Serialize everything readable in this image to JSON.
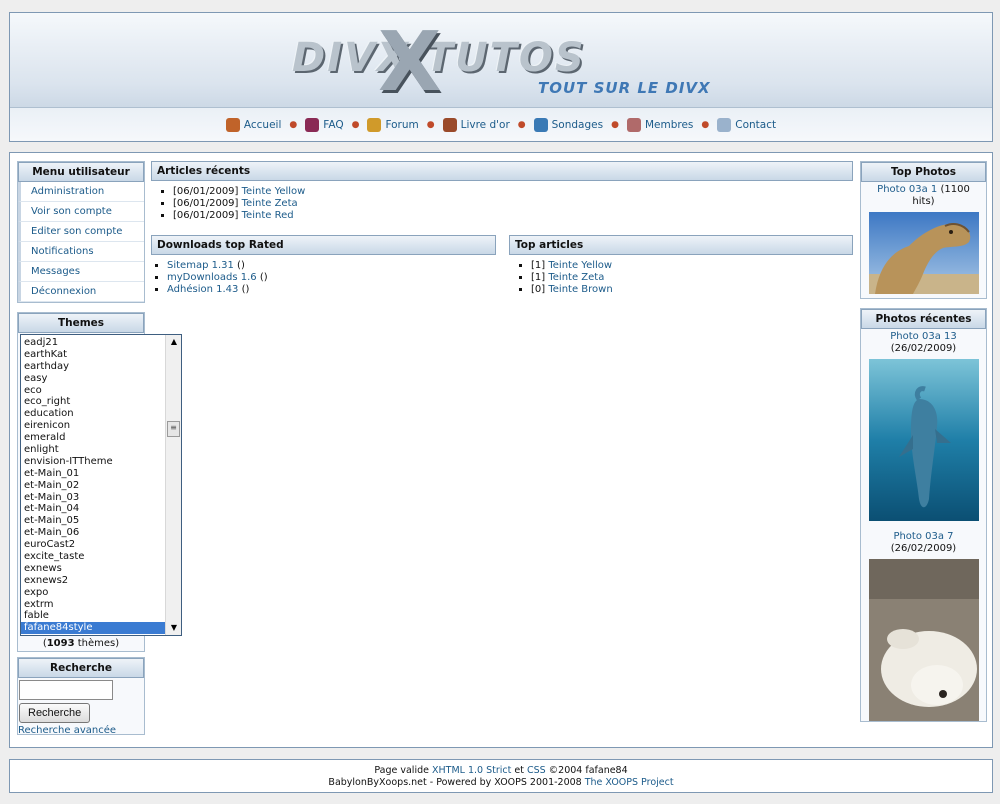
{
  "header": {
    "logo_title": "DIVX TUTOS",
    "logo_x": "X",
    "logo_tagline": "TOUT SUR LE DIVX",
    "nav": [
      {
        "label": "Accueil",
        "icon": "home-icon",
        "color": "#c0632a"
      },
      {
        "label": "FAQ",
        "icon": "book-icon",
        "color": "#8a2a55"
      },
      {
        "label": "Forum",
        "icon": "gift-icon",
        "color": "#d09a2a"
      },
      {
        "label": "Livre d'or",
        "icon": "guestbook-icon",
        "color": "#9a4a2a"
      },
      {
        "label": "Sondages",
        "icon": "poll-icon",
        "color": "#3a7ab5"
      },
      {
        "label": "Membres",
        "icon": "members-icon",
        "color": "#b06a6a"
      },
      {
        "label": "Contact",
        "icon": "contact-icon",
        "color": "#9ab2cc"
      }
    ],
    "nav_separator": "●"
  },
  "user_menu": {
    "title": "Menu utilisateur",
    "items": [
      "Administration",
      "Voir son compte",
      "Editer son compte",
      "Notifications",
      "Messages",
      "Déconnexion"
    ]
  },
  "themes": {
    "title": "Themes",
    "options": [
      "eadj21",
      "earthKat",
      "earthday",
      "easy",
      "eco",
      "eco_right",
      "education",
      "eirenicon",
      "emerald",
      "enlight",
      "envision-ITTheme",
      "et-Main_01",
      "et-Main_02",
      "et-Main_03",
      "et-Main_04",
      "et-Main_05",
      "et-Main_06",
      "euroCast2",
      "excite_taste",
      "exnews",
      "exnews2",
      "expo",
      "extrm",
      "fable",
      "fafane84style"
    ],
    "selected": "fafane84style",
    "count_prefix": "(",
    "count": "1093",
    "count_suffix": " thèmes)"
  },
  "search": {
    "title": "Recherche",
    "input_value": "",
    "button_label": "Recherche",
    "advanced_link": "Recherche avancée"
  },
  "recent_articles": {
    "title": "Articles récents",
    "items": [
      {
        "date": "[06/01/2009]",
        "link": "Teinte Yellow"
      },
      {
        "date": "[06/01/2009]",
        "link": "Teinte Zeta"
      },
      {
        "date": "[06/01/2009]",
        "link": "Teinte Red"
      }
    ]
  },
  "downloads": {
    "title": "Downloads top Rated",
    "items": [
      {
        "link": "Sitemap 1.31",
        "suffix": " ()"
      },
      {
        "link": "myDownloads 1.6",
        "suffix": " ()"
      },
      {
        "link": "Adhésion 1.43",
        "suffix": " ()"
      }
    ]
  },
  "top_articles": {
    "title": "Top articles",
    "items": [
      {
        "count": "[1]",
        "link": "Teinte Yellow"
      },
      {
        "count": "[1]",
        "link": "Teinte Zeta"
      },
      {
        "count": "[0]",
        "link": "Teinte Brown"
      }
    ]
  },
  "top_photos": {
    "title": "Top Photos",
    "photo_link": "Photo 03a 1",
    "photo_hits": " (1100 hits)"
  },
  "recent_photos": {
    "title": "Photos récentes",
    "photos": [
      {
        "link": "Photo 03a 13",
        "date": " (26/02/2009)"
      },
      {
        "link": "Photo 03a 7",
        "date": " (26/02/2009)"
      }
    ]
  },
  "footer": {
    "line1_prefix": "Page valide ",
    "xhtml_link": "XHTML 1.0 Strict",
    "line1_mid": " et ",
    "css_link": "CSS",
    "line1_suffix": "  ©2004 fafane84",
    "line2_prefix": "BabylonByXoops.net - Powered by XOOPS 2001-2008 ",
    "xoops_link": "The XOOPS Project"
  },
  "colors": {
    "link": "#1c5b8a",
    "border": "#7e98b3",
    "title_gradient_bottom": "#c9d8e7",
    "selected_option": "#3a7bd2"
  }
}
